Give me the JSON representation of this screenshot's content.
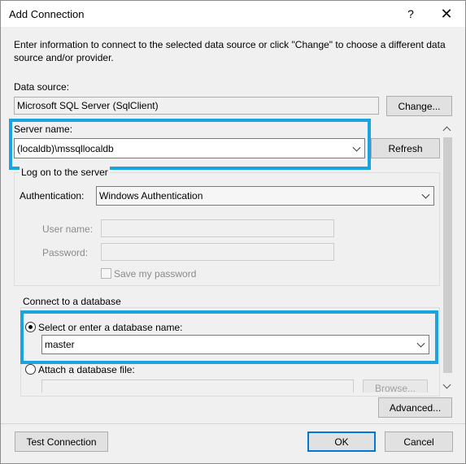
{
  "window": {
    "title": "Add Connection",
    "help_glyph": "?",
    "close_glyph": "✕"
  },
  "intro": "Enter information to connect to the selected data source or click \"Change\" to choose a different data source and/or provider.",
  "data_source": {
    "label": "Data source:",
    "value": "Microsoft SQL Server (SqlClient)",
    "change_button": "Change..."
  },
  "server": {
    "label": "Server name:",
    "value": "(localdb)\\mssqllocaldb",
    "refresh_button": "Refresh"
  },
  "logon": {
    "group_label": "Log on to the server",
    "auth_label": "Authentication:",
    "auth_value": "Windows Authentication",
    "user_label": "User name:",
    "user_value": "",
    "password_label": "Password:",
    "password_value": "",
    "save_password_label": "Save my password"
  },
  "database": {
    "group_label": "Connect to a database",
    "select_label": "Select or enter a database name:",
    "select_value": "master",
    "attach_label": "Attach a database file:",
    "attach_value": "",
    "browse_button": "Browse..."
  },
  "buttons": {
    "advanced": "Advanced...",
    "test": "Test Connection",
    "ok": "OK",
    "cancel": "Cancel"
  },
  "colors": {
    "highlight": "#1aa3e0",
    "default_button_border": "#0078d7"
  }
}
